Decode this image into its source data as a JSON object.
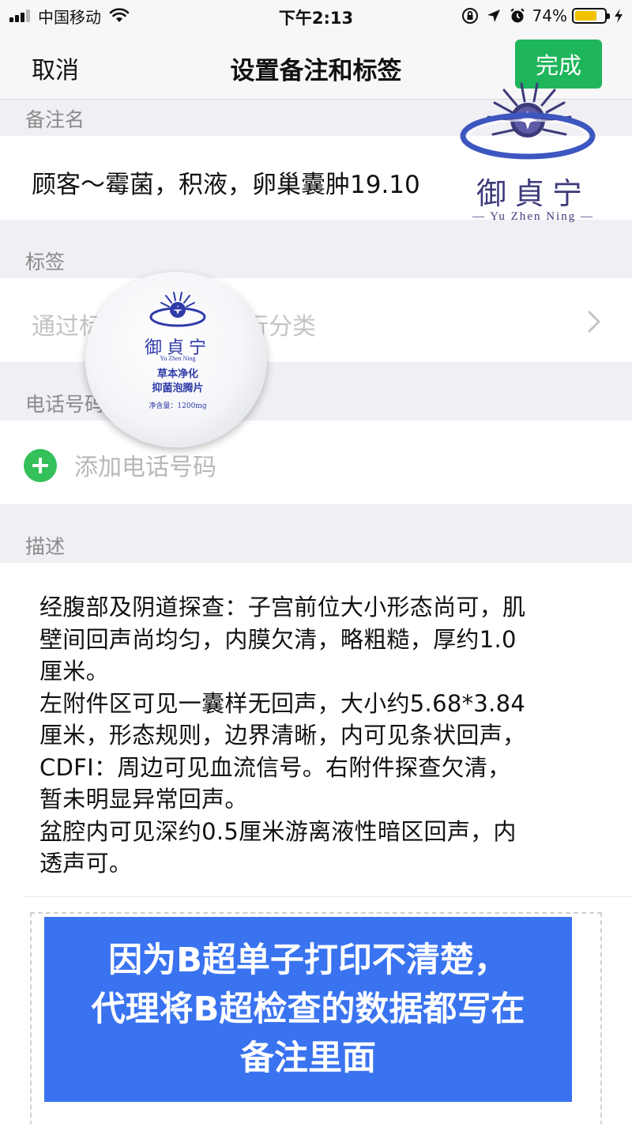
{
  "status_bar": {
    "carrier": "中国移动",
    "time": "下午2:13",
    "battery_percent": "74%",
    "battery_level": 0.74,
    "icons": [
      "signal-icon",
      "wifi-icon",
      "orientation-lock-icon",
      "location-icon",
      "alarm-icon",
      "battery-icon",
      "charging-icon"
    ]
  },
  "nav": {
    "cancel_label": "取消",
    "title": "设置备注和标签",
    "done_label": "完成",
    "done_color": "#1fb55b"
  },
  "remark": {
    "section_label": "备注名",
    "value": "顾客～霉菌，积液，卵巢囊肿19.10"
  },
  "tags": {
    "section_label": "标签",
    "placeholder": "通过标签给联系人进行分类"
  },
  "phone": {
    "section_label": "电话号码",
    "placeholder": "添加电话号码"
  },
  "description": {
    "section_label": "描述",
    "text": "经腹部及阴道探查：子宫前位大小形态尚可，肌\n壁间回声尚均匀，内膜欠清，略粗糙，厚约1.0\n厘米。\n左附件区可见一囊样无回声，大小约5.68*3.84\n厘米，形态规则，边界清晰，内可见条状回声，\nCDFI：周边可见血流信号。右附件探查欠清，\n暂未明显异常回声。\n盆腔内可见深约0.5厘米游离液性暗区回声，内\n透声可。"
  },
  "banner": {
    "lines": [
      "因为B超单子打印不清楚，",
      "代理将B超检查的数据都写在",
      "备注里面"
    ],
    "color": "#3a73f0"
  },
  "logo": {
    "brand": "御貞宁",
    "subtitle": "— Yu Zhen Ning —"
  },
  "product": {
    "brand": "御貞宁",
    "subtitle": "Yu Zhen Ning",
    "line1": "草本净化",
    "line2": "抑菌泡腾片",
    "net": "净含量：1200mg"
  }
}
